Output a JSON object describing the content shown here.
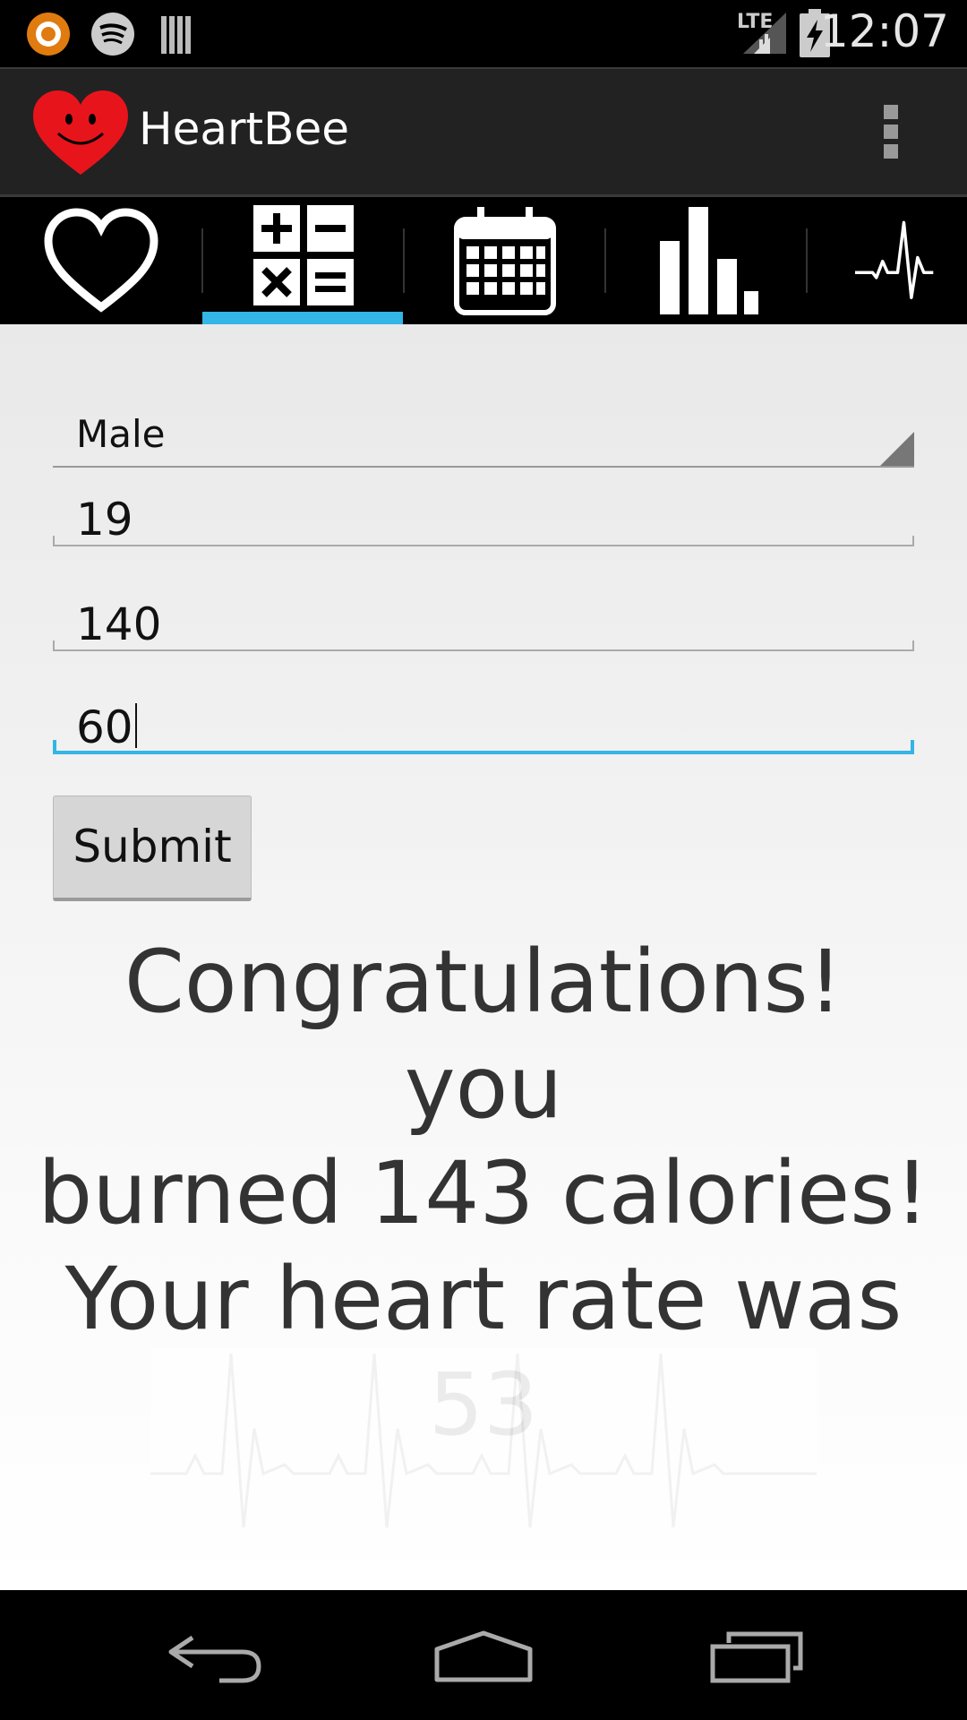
{
  "status_bar": {
    "time": "12:07",
    "network_label": "LTE",
    "icons": [
      "avast-icon",
      "spotify-icon",
      "library-icon",
      "lte-signal-icon",
      "battery-charging-icon"
    ]
  },
  "action_bar": {
    "title": "HeartBee",
    "logo_icon": "heart-smiley-icon",
    "overflow_icon": "overflow-menu-icon"
  },
  "tabs": [
    {
      "icon": "heart-outline-icon",
      "selected": false
    },
    {
      "icon": "calculator-icon",
      "selected": true
    },
    {
      "icon": "calendar-icon",
      "selected": false
    },
    {
      "icon": "bar-chart-icon",
      "selected": false
    },
    {
      "icon": "heartbeat-icon",
      "selected": false
    }
  ],
  "form": {
    "gender": "Male",
    "age": "19",
    "weight": "140",
    "minutes": "60",
    "submit_label": "Submit"
  },
  "result": {
    "line1": "Congratulations! you",
    "line2": "burned 143 calories!",
    "line3": "Your heart rate was",
    "line4": "53"
  },
  "nav_bar": {
    "icons": [
      "back-icon",
      "home-icon",
      "recents-icon"
    ]
  },
  "colors": {
    "accent": "#33b5e5",
    "logo_red": "#e8141b",
    "action_bar": "#222222"
  }
}
